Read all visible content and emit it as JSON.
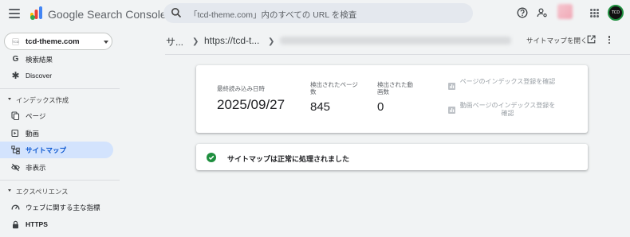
{
  "app": {
    "title": "Google Search Console"
  },
  "search": {
    "placeholder": "「tcd-theme.com」内のすべての URL を検査"
  },
  "property": {
    "favicon_text": "TCD",
    "name": "tcd-theme.com"
  },
  "profile": {
    "initials": "TCD"
  },
  "sidebar": {
    "items": [
      {
        "label": "検索結果",
        "icon": "google-g-icon"
      },
      {
        "label": "Discover",
        "icon": "asterisk-icon"
      }
    ],
    "section_index": "インデックス作成",
    "index_items": [
      {
        "label": "ページ",
        "icon": "pages-icon"
      },
      {
        "label": "動画",
        "icon": "video-icon"
      },
      {
        "label": "サイトマップ",
        "icon": "sitemap-icon",
        "active": true
      },
      {
        "label": "非表示",
        "icon": "eye-off-icon"
      }
    ],
    "section_experience": "エクスペリエンス",
    "experience_items": [
      {
        "label": "ウェブに関する主な指標",
        "icon": "gauge-icon"
      },
      {
        "label": "HTTPS",
        "icon": "lock-icon"
      }
    ]
  },
  "header": {
    "crumb_1": "サ...",
    "crumb_2": "https://tcd-t...",
    "open_sitemap": "サイトマップを開く"
  },
  "stats": {
    "last_read_label": "最終読み込み日時",
    "last_read_value": "2025/09/27",
    "pages_label": "検出されたページ数",
    "pages_value": "845",
    "videos_label": "検出された動画数",
    "videos_value": "0",
    "action_pages": "ページのインデックス登録を確認",
    "action_videos": "動画ページのインデックス登録を確認"
  },
  "status": {
    "message": "サイトマップは正常に処理されました"
  },
  "colors": {
    "active_bg": "#d3e3fd",
    "active_text": "#0b57d0",
    "success": "#1e8e3e"
  }
}
